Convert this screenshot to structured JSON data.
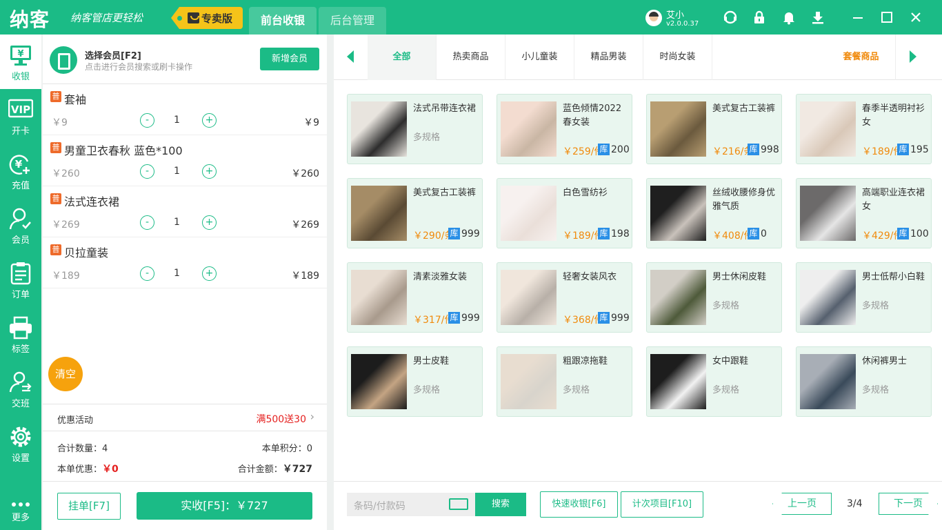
{
  "app": {
    "logo": "纳客",
    "slogan": "纳客管店更轻松",
    "edition": "专卖版"
  },
  "nav": {
    "tabs": [
      {
        "label": "前台收银",
        "active": true
      },
      {
        "label": "后台管理",
        "active": false
      }
    ]
  },
  "user": {
    "name": "艾小",
    "version": "v2.0.0.37"
  },
  "sidebar": {
    "items": [
      {
        "label": "收银",
        "icon": "monitor-yen-icon",
        "active": true
      },
      {
        "label": "开卡",
        "icon": "vip-card-icon"
      },
      {
        "label": "充值",
        "icon": "yen-plus-icon"
      },
      {
        "label": "会员",
        "icon": "member-icon"
      },
      {
        "label": "订单",
        "icon": "order-list-icon"
      },
      {
        "label": "标签",
        "icon": "printer-icon"
      },
      {
        "label": "交班",
        "icon": "shift-handover-icon"
      },
      {
        "label": "设置",
        "icon": "gear-icon"
      },
      {
        "label": "更多",
        "icon": "more-dots-icon"
      }
    ]
  },
  "member": {
    "title": "选择会员[F2]",
    "hint": "点击进行会员搜索或刷卡操作",
    "add_label": "新增会员"
  },
  "cart": {
    "tag": "普",
    "items": [
      {
        "name": "套袖",
        "unit_price": "￥9",
        "qty": "1",
        "total": "￥9"
      },
      {
        "name": "男童卫衣春秋 蓝色*100",
        "unit_price": "￥260",
        "qty": "1",
        "total": "￥260"
      },
      {
        "name": "法式连衣裙",
        "unit_price": "￥269",
        "qty": "1",
        "total": "￥269"
      },
      {
        "name": "贝拉童装",
        "unit_price": "￥189",
        "qty": "1",
        "total": "￥189"
      }
    ],
    "clear_label": "清空"
  },
  "promo": {
    "label": "优惠活动",
    "value": "满500送30"
  },
  "summary": {
    "qty_label": "合计数量：",
    "qty": "4",
    "points_label": "本单积分：",
    "points": "0",
    "discount_label": "本单优惠：",
    "discount": "￥0",
    "total_label": "合计金额：",
    "total": "￥727"
  },
  "actions": {
    "hold_label": "挂单[F7]",
    "pay_label": "实收[F5]：￥727"
  },
  "categories": {
    "items": [
      "全部",
      "热卖商品",
      "小儿童装",
      "精品男装",
      "时尚女装"
    ],
    "package": "套餐商品"
  },
  "products": [
    {
      "name": "法式吊带连衣裙",
      "spec": "多规格"
    },
    {
      "name": "蓝色倾情2022春女装",
      "price": "￥259/件",
      "stock": "200"
    },
    {
      "name": "美式复古工装裤",
      "price": "￥216/条",
      "stock": "998"
    },
    {
      "name": "春季半透明衬衫女",
      "price": "￥189/件",
      "stock": "195"
    },
    {
      "name": "美式复古工装裤",
      "price": "￥290/条",
      "stock": "999"
    },
    {
      "name": "白色雪纺衫",
      "price": "￥189/件",
      "stock": "198"
    },
    {
      "name": "丝绒收腰修身优雅气质",
      "price": "￥408/件",
      "stock": "0"
    },
    {
      "name": "高端职业连衣裙女",
      "price": "￥429/件",
      "stock": "100"
    },
    {
      "name": "清素淡雅女装",
      "price": "￥317/件",
      "stock": "999"
    },
    {
      "name": "轻奢女装风衣",
      "price": "￥368/件",
      "stock": "999"
    },
    {
      "name": "男士休闲皮鞋",
      "spec": "多规格"
    },
    {
      "name": "男士低帮小白鞋",
      "spec": "多规格"
    },
    {
      "name": "男士皮鞋",
      "spec": "多规格"
    },
    {
      "name": "粗跟凉拖鞋",
      "spec": "多规格"
    },
    {
      "name": "女中跟鞋",
      "spec": "多规格"
    },
    {
      "name": "休闲裤男士",
      "spec": "多规格"
    }
  ],
  "stock_tag": "库",
  "bottom": {
    "barcode_placeholder": "条码/付款码",
    "search_label": "搜索",
    "quick_label": "快速收银[F6]",
    "count_label": "计次项目[F10]",
    "prev_label": "上一页",
    "page": "3/4",
    "next_label": "下一页"
  },
  "colors": {
    "brand": "#1bbb86",
    "orange": "#f08a0c",
    "red": "#e5201f",
    "stock_blue": "#2a8fe6"
  }
}
